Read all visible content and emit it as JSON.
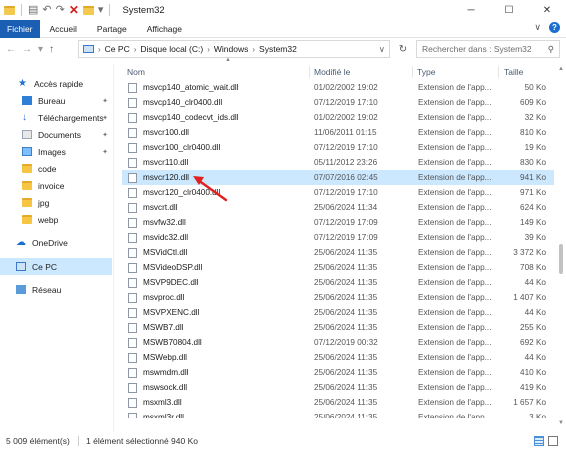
{
  "window": {
    "title": "System32",
    "minimize": "─",
    "maximize": "☐",
    "close": "✕"
  },
  "ribbon": {
    "tabs": [
      "Fichier",
      "Accueil",
      "Partage",
      "Affichage"
    ],
    "expand": "∨",
    "help": "?"
  },
  "address": {
    "crumbs": [
      "Ce PC",
      "Disque local (C:)",
      "Windows",
      "System32"
    ],
    "search_placeholder": "Rechercher dans : System32"
  },
  "sidebar": {
    "items": [
      {
        "label": "Accès rapide",
        "icon": "star-icon"
      },
      {
        "label": "Bureau",
        "icon": "desktop-icon",
        "pinned": true
      },
      {
        "label": "Téléchargements",
        "icon": "download-icon",
        "pinned": true
      },
      {
        "label": "Documents",
        "icon": "documents-icon",
        "pinned": true
      },
      {
        "label": "Images",
        "icon": "pictures-icon",
        "pinned": true
      },
      {
        "label": "code",
        "icon": "folder-icon"
      },
      {
        "label": "invoice",
        "icon": "folder-icon"
      },
      {
        "label": "jpg",
        "icon": "folder-icon"
      },
      {
        "label": "webp",
        "icon": "folder-icon"
      },
      {
        "label": "OneDrive",
        "icon": "cloud-icon"
      },
      {
        "label": "Ce PC",
        "icon": "computer-icon",
        "selected": true
      },
      {
        "label": "Réseau",
        "icon": "network-icon"
      }
    ]
  },
  "columns": {
    "name": "Nom",
    "modified": "Modifié le",
    "type": "Type",
    "size": "Taille"
  },
  "files": [
    {
      "name": "msvcp140_atomic_wait.dll",
      "date": "01/02/2002 19:02",
      "type": "Extension de l'app...",
      "size": "50 Ko"
    },
    {
      "name": "msvcp140_clr0400.dll",
      "date": "07/12/2019 17:10",
      "type": "Extension de l'app...",
      "size": "609 Ko"
    },
    {
      "name": "msvcp140_codecvt_ids.dll",
      "date": "01/02/2002 19:02",
      "type": "Extension de l'app...",
      "size": "32 Ko"
    },
    {
      "name": "msvcr100.dll",
      "date": "11/06/2011 01:15",
      "type": "Extension de l'app...",
      "size": "810 Ko"
    },
    {
      "name": "msvcr100_clr0400.dll",
      "date": "07/12/2019 17:10",
      "type": "Extension de l'app...",
      "size": "19 Ko"
    },
    {
      "name": "msvcr110.dll",
      "date": "05/11/2012 23:26",
      "type": "Extension de l'app...",
      "size": "830 Ko"
    },
    {
      "name": "msvcr120.dll",
      "date": "07/07/2016 02:45",
      "type": "Extension de l'app...",
      "size": "941 Ko",
      "selected": true
    },
    {
      "name": "msvcr120_clr0400.dll",
      "date": "07/12/2019 17:10",
      "type": "Extension de l'app...",
      "size": "971 Ko"
    },
    {
      "name": "msvcrt.dll",
      "date": "25/06/2024 11:34",
      "type": "Extension de l'app...",
      "size": "624 Ko"
    },
    {
      "name": "msvfw32.dll",
      "date": "07/12/2019 17:09",
      "type": "Extension de l'app...",
      "size": "149 Ko"
    },
    {
      "name": "msvidc32.dll",
      "date": "07/12/2019 17:09",
      "type": "Extension de l'app...",
      "size": "39 Ko"
    },
    {
      "name": "MSVidCtl.dll",
      "date": "25/06/2024 11:35",
      "type": "Extension de l'app...",
      "size": "3 372 Ko"
    },
    {
      "name": "MSVideoDSP.dll",
      "date": "25/06/2024 11:35",
      "type": "Extension de l'app...",
      "size": "708 Ko"
    },
    {
      "name": "MSVP9DEC.dll",
      "date": "25/06/2024 11:35",
      "type": "Extension de l'app...",
      "size": "44 Ko"
    },
    {
      "name": "msvproc.dll",
      "date": "25/06/2024 11:35",
      "type": "Extension de l'app...",
      "size": "1 407 Ko"
    },
    {
      "name": "MSVPXENC.dll",
      "date": "25/06/2024 11:35",
      "type": "Extension de l'app...",
      "size": "44 Ko"
    },
    {
      "name": "MSWB7.dll",
      "date": "25/06/2024 11:35",
      "type": "Extension de l'app...",
      "size": "255 Ko"
    },
    {
      "name": "MSWB70804.dll",
      "date": "07/12/2019 00:32",
      "type": "Extension de l'app...",
      "size": "692 Ko"
    },
    {
      "name": "MSWebp.dll",
      "date": "25/06/2024 11:35",
      "type": "Extension de l'app...",
      "size": "44 Ko"
    },
    {
      "name": "mswmdm.dll",
      "date": "25/06/2024 11:35",
      "type": "Extension de l'app...",
      "size": "410 Ko"
    },
    {
      "name": "mswsock.dll",
      "date": "25/06/2024 11:35",
      "type": "Extension de l'app...",
      "size": "419 Ko"
    },
    {
      "name": "msxml3.dll",
      "date": "25/06/2024 11:35",
      "type": "Extension de l'app...",
      "size": "1 657 Ko"
    },
    {
      "name": "msxml3r.dll",
      "date": "25/06/2024 11:35",
      "type": "Extension de l'app...",
      "size": "3 Ko"
    }
  ],
  "status": {
    "count": "5 009 élément(s)",
    "selection": "1 élément sélectionné  940 Ko"
  },
  "colors": {
    "selection": "#cce8ff",
    "file_tab": "#1a5fb4",
    "annotation_arrow": "#e0211f"
  }
}
